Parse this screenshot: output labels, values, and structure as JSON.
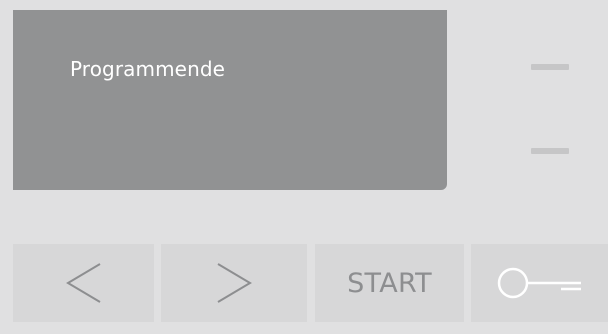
{
  "display": {
    "status_text": "Programmende"
  },
  "buttons": {
    "start_label": "START",
    "prev_icon": "chevron-left-icon",
    "next_icon": "chevron-right-icon",
    "lock_icon": "key-lock-icon"
  },
  "colors": {
    "background": "#e0e0e1",
    "display": "#919293",
    "button": "#d7d7d8",
    "button_symbol": "#8d8e90",
    "indicator": "#c6c6c7"
  }
}
